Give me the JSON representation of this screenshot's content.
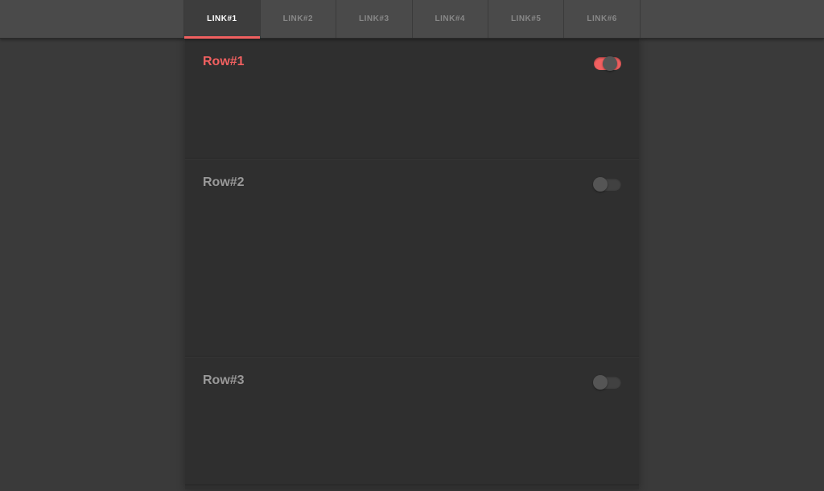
{
  "tabs": [
    {
      "label": "LINK#1",
      "active": true
    },
    {
      "label": "LINK#2",
      "active": false
    },
    {
      "label": "LINK#3",
      "active": false
    },
    {
      "label": "LINK#4",
      "active": false
    },
    {
      "label": "LINK#5",
      "active": false
    },
    {
      "label": "LINK#6",
      "active": false
    }
  ],
  "rows": [
    {
      "label": "Row#1",
      "highlighted": true,
      "toggle_on": true
    },
    {
      "label": "Row#2",
      "highlighted": false,
      "toggle_on": false
    },
    {
      "label": "Row#3",
      "highlighted": false,
      "toggle_on": false
    }
  ]
}
